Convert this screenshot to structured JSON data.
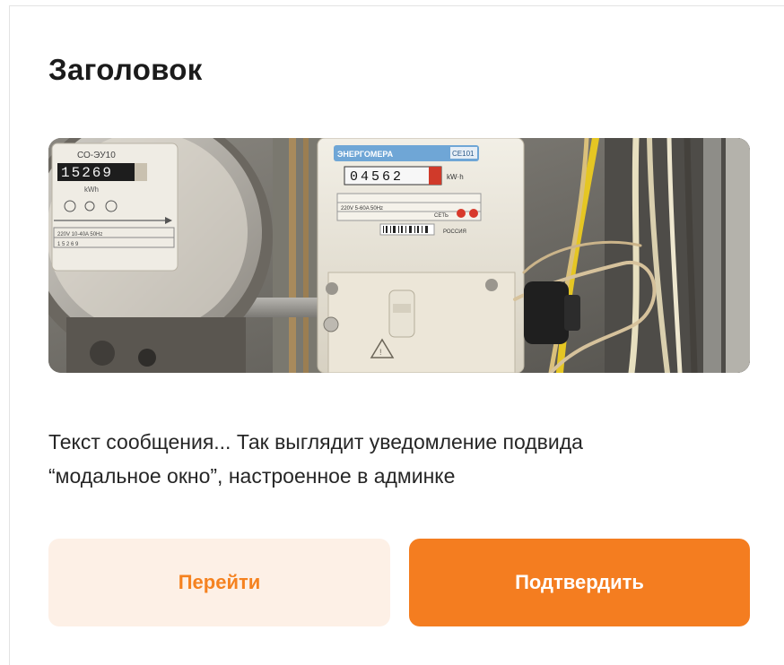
{
  "modal": {
    "title": "Заголовок",
    "message_line1": "Текст сообщения... Так выглядит уведомление подвида",
    "message_line2": "“модальное окно”, настроенное в админке",
    "image_alt": "electric-meters-photo"
  },
  "meter_left": {
    "model": "СО-ЭУ10",
    "reading": "15269",
    "unit": "kWh",
    "spec": "220V 10-40A 50Hz"
  },
  "meter_right": {
    "brand": "ЭНЕРГОМЕРА",
    "model": "СЕ101",
    "reading": "04562",
    "unit": "kW·h",
    "spec": "220V 5-60A 50Hz",
    "label_country": "РОССИЯ",
    "label_net": "СЕТЬ"
  },
  "buttons": {
    "secondary_label": "Перейти",
    "primary_label": "Подтвердить"
  },
  "colors": {
    "accent": "#f47d20",
    "accent_light": "#fdf0e6",
    "text": "#1f1f1f"
  }
}
